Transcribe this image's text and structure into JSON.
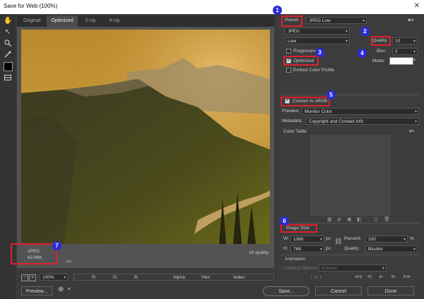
{
  "window": {
    "title": "Save for Web (100%)"
  },
  "tabs": [
    "Original",
    "Optimized",
    "2-Up",
    "4-Up"
  ],
  "preview": {
    "status_format": "JPEG",
    "status_size": "62.86K",
    "quality_readout": "10 quality"
  },
  "zoom": "100%",
  "readouts": {
    "r": "R:",
    "g": "G:",
    "b": "B:",
    "alpha": "Alpha:",
    "hex": "Hex:",
    "index": "Index:"
  },
  "settings": {
    "preset_label": "Preset:",
    "preset_value": "JPEG Low",
    "format": "JPEG",
    "quality_level": "Low",
    "quality_label": "Quality:",
    "quality_value": "10",
    "progressive_label": "Progressive",
    "blur_label": "Blur:",
    "blur_value": "0",
    "optimized_label": "Optimized",
    "matte_label": "Matte:",
    "embed_profile_label": "Embed Color Profile",
    "convert_srgb_label": "Convert to sRGB",
    "preview_label": "Preview:",
    "preview_value": "Monitor Color",
    "metadata_label": "Metadata:",
    "metadata_value": "Copyright and Contact Info",
    "color_table_label": "Color Table"
  },
  "image_size": {
    "header": "Image Size",
    "w_label": "W:",
    "w_value": "1366",
    "h_label": "H:",
    "h_value": "768",
    "unit": "px",
    "percent_label": "Percent:",
    "percent_value": "100",
    "percent_unit": "%",
    "quality_label": "Quality:",
    "quality_value": "Bicubic"
  },
  "animation": {
    "header": "Animation",
    "looping_label": "Looping Options:",
    "looping_value": "Forever",
    "frame_counter": "1 of 1"
  },
  "buttons": {
    "preview": "Preview...",
    "save": "Save...",
    "cancel": "Cancel",
    "done": "Done"
  },
  "callouts": [
    "1",
    "2",
    "3",
    "4",
    "5",
    "6",
    "7"
  ],
  "colors": {
    "callout_blue": "#2b2bd6",
    "highlight_red": "#e0202e",
    "panel_bg": "#3c3c3c"
  }
}
